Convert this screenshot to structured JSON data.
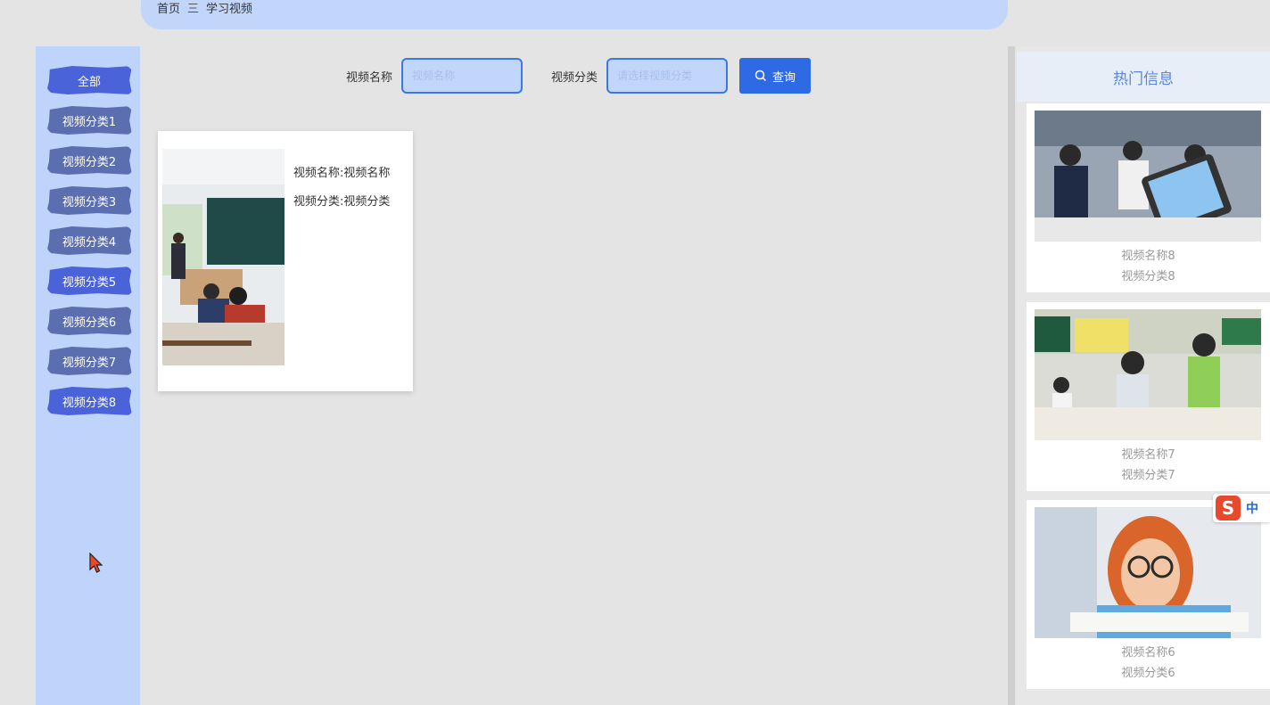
{
  "breadcrumb": {
    "home": "首页",
    "separator": "三",
    "current": "学习视频"
  },
  "sidebar": {
    "items": [
      {
        "label": "全部",
        "active": true
      },
      {
        "label": "视频分类1"
      },
      {
        "label": "视频分类2"
      },
      {
        "label": "视频分类3"
      },
      {
        "label": "视频分类4"
      },
      {
        "label": "视频分类5"
      },
      {
        "label": "视频分类6"
      },
      {
        "label": "视频分类7"
      },
      {
        "label": "视频分类8"
      }
    ]
  },
  "search": {
    "name_label": "视频名称",
    "name_placeholder": "视频名称",
    "category_label": "视频分类",
    "category_placeholder": "请选择视频分类",
    "button_label": "查询",
    "button_icon": "search-icon"
  },
  "video_card": {
    "name_line": "视频名称:视频名称",
    "category_line": "视频分类:视频分类"
  },
  "hot": {
    "title": "热门信息",
    "items": [
      {
        "name": "视频名称8",
        "category": "视频分类8"
      },
      {
        "name": "视频名称7",
        "category": "视频分类7"
      },
      {
        "name": "视频名称6",
        "category": "视频分类6"
      }
    ]
  },
  "ime": {
    "logo": "S",
    "mode": "中"
  },
  "colors": {
    "accent": "#2d6ae4",
    "sidebar_bg": "#bfd4fb",
    "topbar_bg": "#c2d6fb",
    "category_button": "#5b6fb0"
  }
}
